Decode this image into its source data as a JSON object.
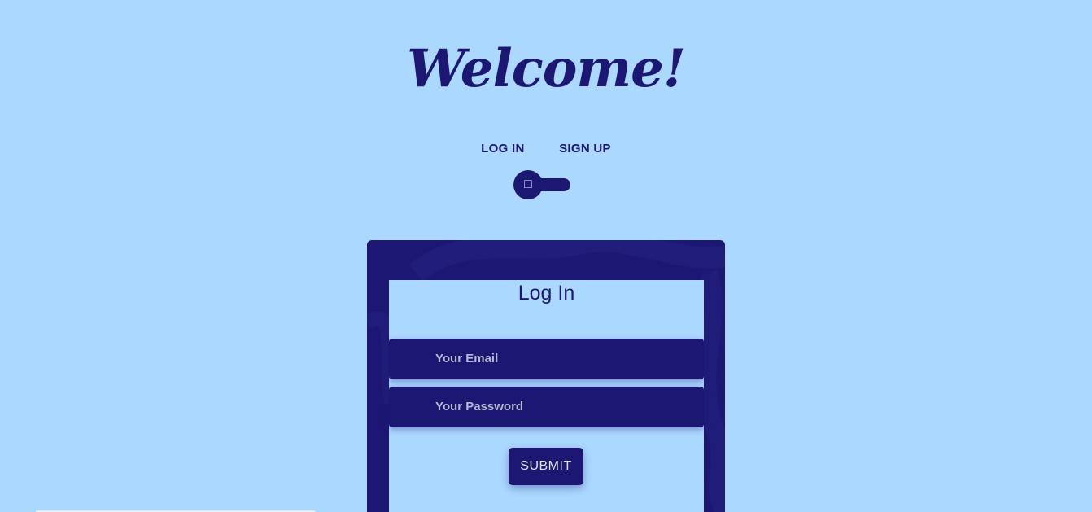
{
  "header": {
    "title": "Welcome!"
  },
  "toggle": {
    "login_label": "LOG IN",
    "signup_label": "SIGN UP",
    "knob_glyph": "□"
  },
  "form": {
    "title": "Log In",
    "email_placeholder": "Your Email",
    "password_placeholder": "Your Password",
    "submit_label": "SUBMIT"
  },
  "colors": {
    "background": "#abd8ff",
    "accent": "#1b1773"
  }
}
